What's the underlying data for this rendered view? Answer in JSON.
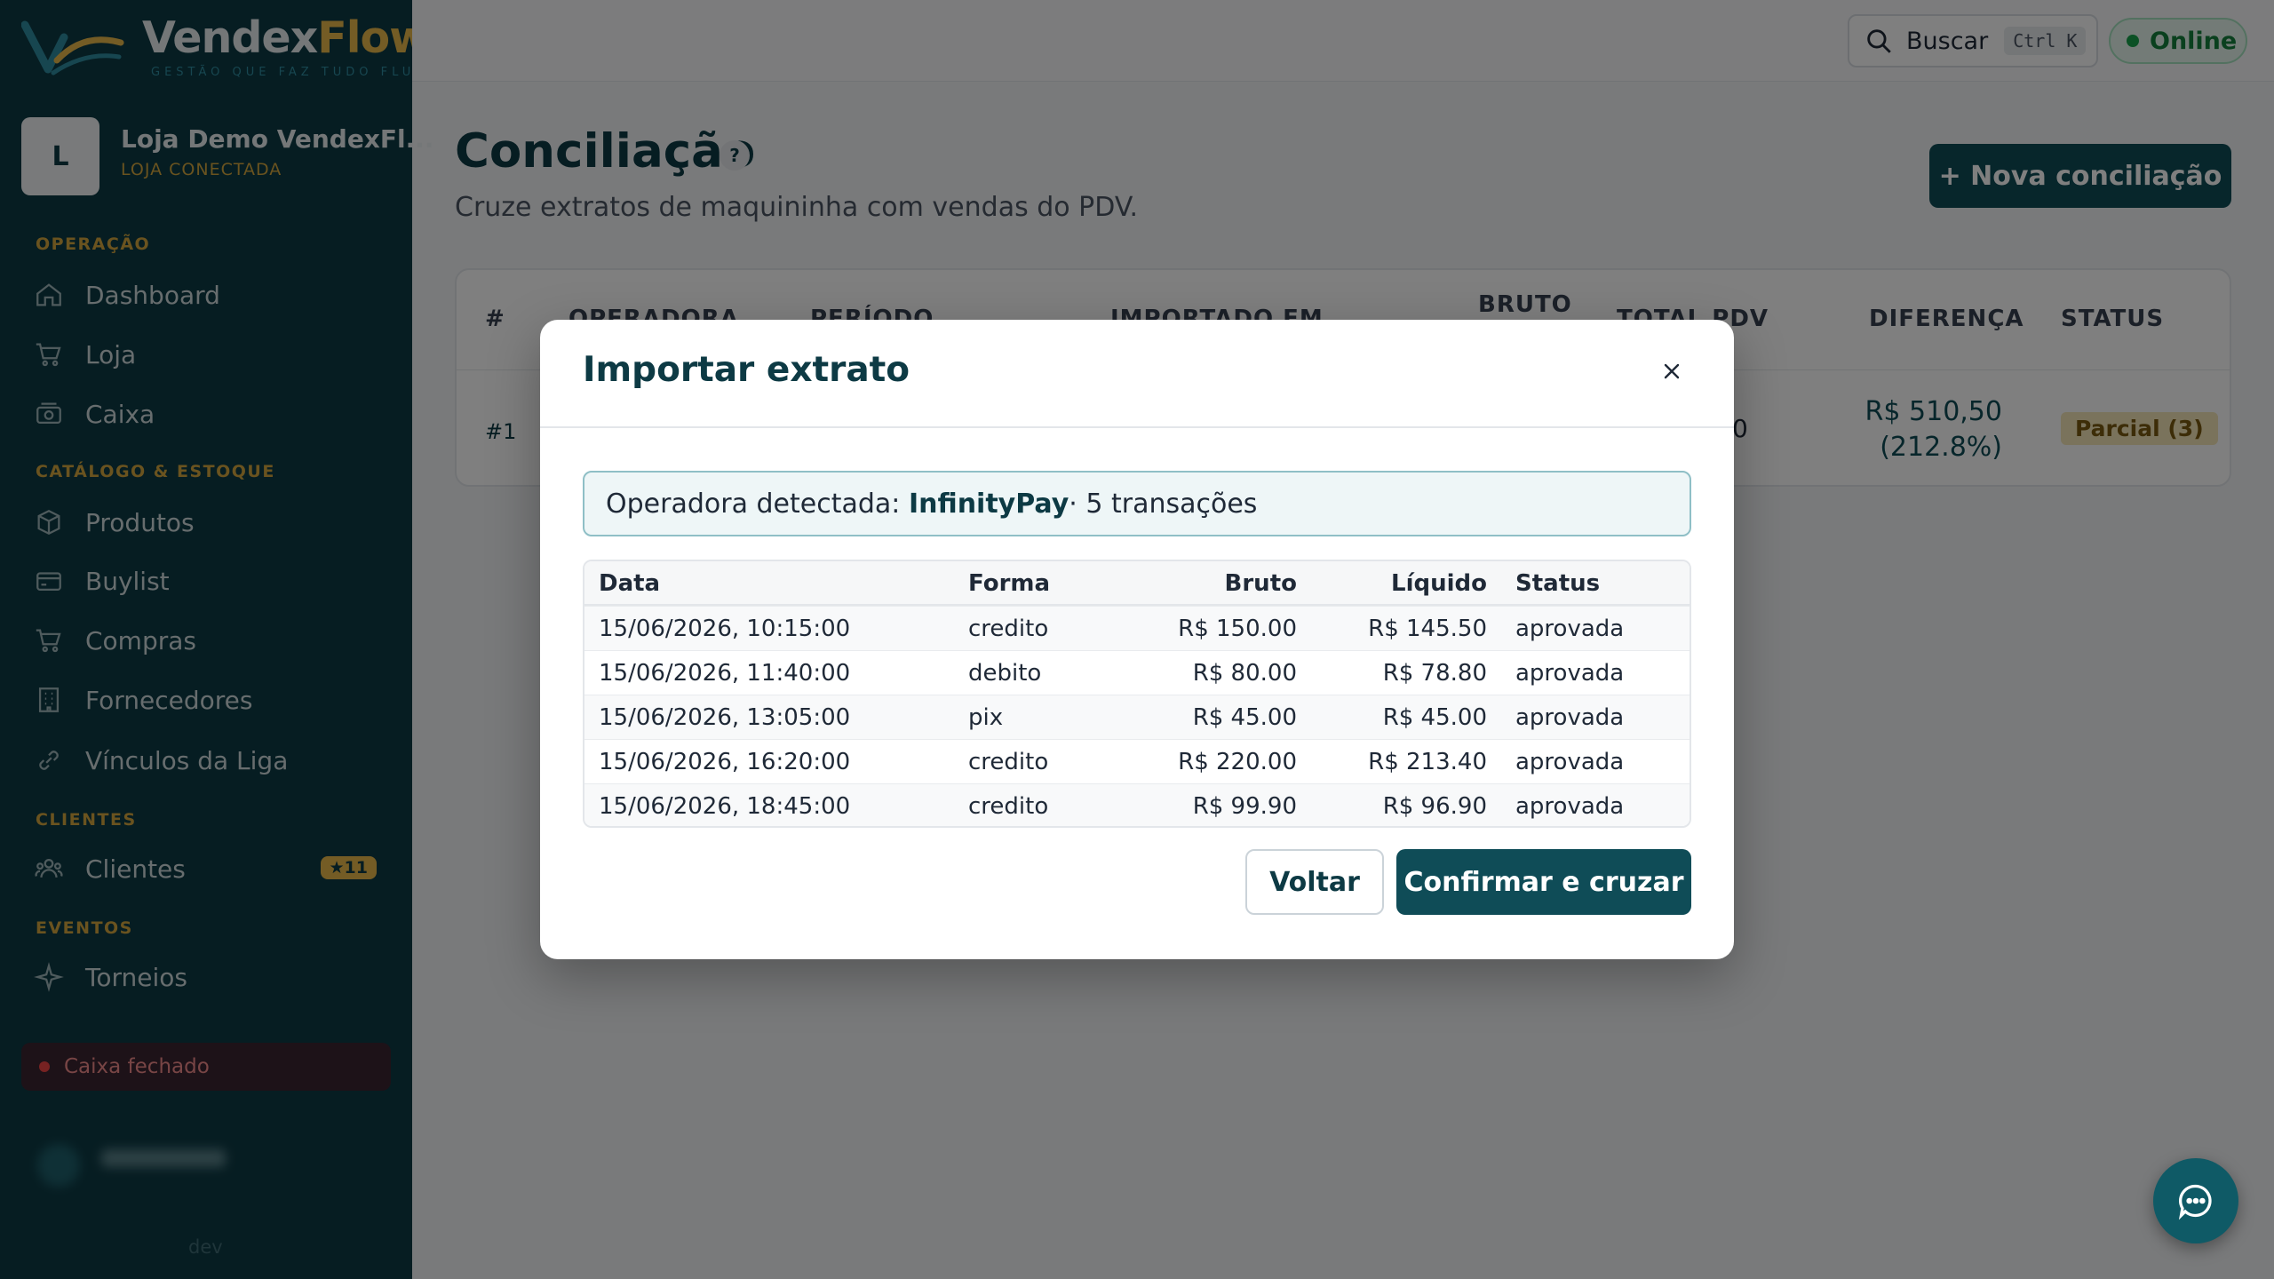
{
  "brand": {
    "name_part1": "Vendex",
    "name_part2": "Flow",
    "tagline": "GESTÃO QUE FAZ TUDO FLUIR"
  },
  "store": {
    "avatar_letter": "L",
    "name": "Loja Demo VendexFl...",
    "status": "LOJA CONECTADA"
  },
  "sidebar": {
    "sections": [
      {
        "label": "OPERAÇÃO"
      },
      {
        "label": "CATÁLOGO & ESTOQUE"
      },
      {
        "label": "CLIENTES"
      },
      {
        "label": "EVENTOS"
      }
    ],
    "items": [
      {
        "label": "Dashboard",
        "icon": "home-icon"
      },
      {
        "label": "Loja",
        "icon": "cart-icon"
      },
      {
        "label": "Caixa",
        "icon": "cash-register-icon"
      },
      {
        "label": "Produtos",
        "icon": "box-icon"
      },
      {
        "label": "Buylist",
        "icon": "card-icon"
      },
      {
        "label": "Compras",
        "icon": "cart-icon"
      },
      {
        "label": "Fornecedores",
        "icon": "building-icon"
      },
      {
        "label": "Vínculos da Liga",
        "icon": "link-icon"
      },
      {
        "label": "Clientes",
        "icon": "users-icon",
        "badge": "★11"
      },
      {
        "label": "Torneios",
        "icon": "sparkle-icon"
      }
    ],
    "cash_status": "Caixa fechado",
    "env_label": "dev"
  },
  "topbar": {
    "search_label": "Buscar",
    "search_shortcut": "Ctrl K",
    "online_label": "Online"
  },
  "page": {
    "title": "Conciliação",
    "help": "?",
    "subtitle": "Cruze extratos de maquininha com vendas do PDV.",
    "new_button": "+ Nova conciliação"
  },
  "reconciliation_table": {
    "headers": [
      "#",
      "OPERADORA",
      "PERÍODO",
      "IMPORTADO EM",
      "BRUTO",
      "TOTAL PDV",
      "DIFERENÇA",
      "STATUS"
    ],
    "rows": [
      {
        "num": "#1",
        "pdv_partial": "0",
        "diff_value": "R$ 510,50",
        "diff_pct": "(212.8%)",
        "status": "Parcial (3)"
      }
    ]
  },
  "modal": {
    "title": "Importar extrato",
    "detect_prefix": "Operadora detectada: ",
    "operator": "InfinityPay",
    "detect_suffix": " · 5 transações",
    "columns": [
      "Data",
      "Forma",
      "Bruto",
      "Líquido",
      "Status"
    ],
    "transactions": [
      {
        "data": "15/06/2026, 10:15:00",
        "forma": "credito",
        "bruto": "R$ 150.00",
        "liquido": "R$ 145.50",
        "status": "aprovada"
      },
      {
        "data": "15/06/2026, 11:40:00",
        "forma": "debito",
        "bruto": "R$ 80.00",
        "liquido": "R$ 78.80",
        "status": "aprovada"
      },
      {
        "data": "15/06/2026, 13:05:00",
        "forma": "pix",
        "bruto": "R$ 45.00",
        "liquido": "R$ 45.00",
        "status": "aprovada"
      },
      {
        "data": "15/06/2026, 16:20:00",
        "forma": "credito",
        "bruto": "R$ 220.00",
        "liquido": "R$ 213.40",
        "status": "aprovada"
      },
      {
        "data": "15/06/2026, 18:45:00",
        "forma": "credito",
        "bruto": "R$ 99.90",
        "liquido": "R$ 96.90",
        "status": "aprovada"
      }
    ],
    "back_label": "Voltar",
    "confirm_label": "Confirmar e cruzar"
  },
  "colors": {
    "brand_dark": "#0d3a44",
    "accent_gold": "#e8b84a",
    "primary_button": "#0f4c57",
    "online_green": "#16a34a"
  }
}
